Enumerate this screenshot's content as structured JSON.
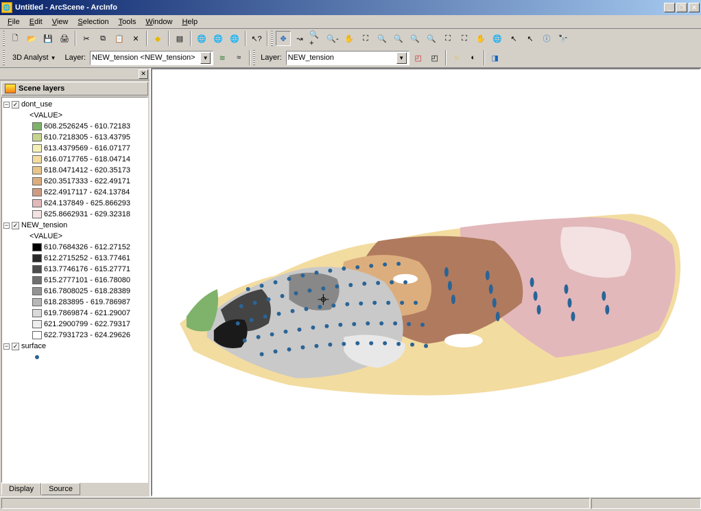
{
  "window": {
    "title": "Untitled - ArcScene - ArcInfo",
    "min": "_",
    "max": "❐",
    "close": "✕"
  },
  "menu": {
    "file": "File",
    "edit": "Edit",
    "view": "View",
    "selection": "Selection",
    "tools": "Tools",
    "window": "Window",
    "help": "Help"
  },
  "toolbar1": {
    "analyst_label": "3D Analyst",
    "layer_label": "Layer:",
    "layer_value": "NEW_tension <NEW_tension>",
    "layer2_label": "Layer:",
    "layer2_value": "NEW_tension"
  },
  "toc": {
    "title": "Scene layers",
    "layers": [
      {
        "name": "dont_use",
        "value_label": "<VALUE>",
        "classes": [
          {
            "color": "#7fb26b",
            "label": "608.2526245 - 610.72183"
          },
          {
            "color": "#c6d48e",
            "label": "610.7218305 - 613.43795"
          },
          {
            "color": "#f5f0b8",
            "label": "613.4379569 - 616.07177"
          },
          {
            "color": "#f3dca0",
            "label": "616.0717765 - 618.04714"
          },
          {
            "color": "#e8c58b",
            "label": "618.0471412 - 620.35173"
          },
          {
            "color": "#dcae7e",
            "label": "620.3517333 - 622.49171"
          },
          {
            "color": "#cf9c83",
            "label": "622.4917117 - 624.13784"
          },
          {
            "color": "#e2b8bb",
            "label": "624.137849 - 625.866293"
          },
          {
            "color": "#f4e2e2",
            "label": "625.8662931 - 629.32318"
          }
        ]
      },
      {
        "name": "NEW_tension",
        "value_label": "<VALUE>",
        "classes": [
          {
            "color": "#000000",
            "label": "610.7684326 - 612.27152"
          },
          {
            "color": "#2a2a2a",
            "label": "612.2715252 - 613.77461"
          },
          {
            "color": "#4d4d4d",
            "label": "613.7746176 - 615.27771"
          },
          {
            "color": "#707070",
            "label": "615.2777101 - 616.78080"
          },
          {
            "color": "#949494",
            "label": "616.7808025 - 618.28389"
          },
          {
            "color": "#b7b7b7",
            "label": "618.283895 - 619.786987"
          },
          {
            "color": "#dadada",
            "label": "619.7869874 - 621.29007"
          },
          {
            "color": "#ededed",
            "label": "621.2900799 - 622.79317"
          },
          {
            "color": "#ffffff",
            "label": "622.7931723 - 624.29626"
          }
        ]
      },
      {
        "name": "surface"
      }
    ],
    "tabs": {
      "display": "Display",
      "source": "Source"
    }
  },
  "icons": {
    "new": "🗋",
    "open": "📂",
    "save": "💾",
    "print": "🖨",
    "cut": "✂",
    "copy": "⧉",
    "paste": "📋",
    "delete": "✕",
    "add": "◆",
    "list": "▤",
    "globe1": "🌐",
    "globe2": "🌐",
    "globe3": "🌐",
    "arrow": "↖?",
    "nav": "✥",
    "fly": "↝",
    "zoomin": "🔍+",
    "zoomout": "🔍-",
    "pan": "✋",
    "full": "⛶",
    "back": "🔍",
    "fwd": "🔍",
    "zin": "🔍",
    "zout": "🔍",
    "ex1": "⛶",
    "ex2": "⛶",
    "hand": "✋",
    "world": "🌐",
    "sel": "↖",
    "ptr": "↖",
    "info": "ⓘ",
    "find": "🔭",
    "interp": "≋",
    "contour": "≈",
    "tb3_1": "◰",
    "tb3_2": "◰",
    "tb3_3": "○",
    "tb3_4": "◐",
    "tb3_5": "◨"
  },
  "colors": {
    "titlebar_left": "#0a246a",
    "titlebar_right": "#a6caf0",
    "ui": "#d4d0c8"
  }
}
